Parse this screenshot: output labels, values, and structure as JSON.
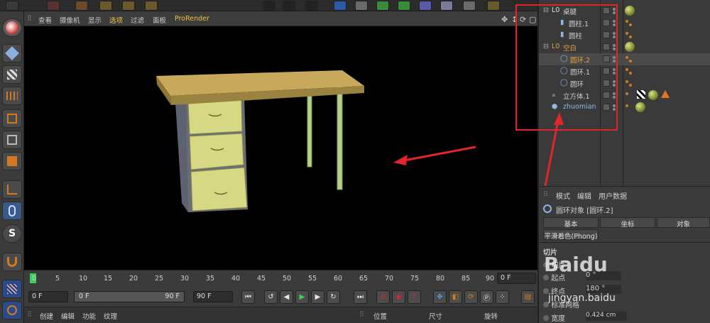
{
  "viewport_menu": [
    "查看",
    "摄像机",
    "显示",
    "选项",
    "过滤",
    "面板",
    "ProRender"
  ],
  "timeline": {
    "ticks": [
      "0",
      "5",
      "10",
      "15",
      "20",
      "25",
      "30",
      "35",
      "40",
      "45",
      "50",
      "55",
      "60",
      "65",
      "70",
      "75",
      "80",
      "85",
      "90"
    ],
    "current_frame": "0 F"
  },
  "playback": {
    "start_field": "0 F",
    "range_start": "0 F",
    "range_end": "90 F",
    "end_field": "90 F"
  },
  "bottom_menu": [
    "创建",
    "编辑",
    "功能",
    "纹理"
  ],
  "coord_headers": [
    "位置",
    "尺寸",
    "旋转"
  ],
  "object_manager": {
    "objects": [
      {
        "name": "桌腿",
        "color": "#cfcfcf",
        "level": 0,
        "icon": "null-group-icon"
      },
      {
        "name": "圆柱.1",
        "color": "#cfcfcf",
        "level": 1,
        "icon": "cylinder-icon"
      },
      {
        "name": "圆柱",
        "color": "#cfcfcf",
        "level": 1,
        "icon": "cylinder-icon"
      },
      {
        "name": "空白",
        "color": "#e0a23a",
        "level": 0,
        "icon": "null-group-icon"
      },
      {
        "name": "圆环.2",
        "color": "#e0a23a",
        "level": 1,
        "icon": "torus-icon"
      },
      {
        "name": "圆环.1",
        "color": "#cfcfcf",
        "level": 1,
        "icon": "torus-icon"
      },
      {
        "name": "圆环",
        "color": "#cfcfcf",
        "level": 1,
        "icon": "torus-icon"
      },
      {
        "name": "立方体.1",
        "color": "#cfcfcf",
        "level": 0,
        "icon": "cube-icon"
      },
      {
        "name": "zhuomian",
        "color": "#8fb8e8",
        "level": 0,
        "icon": "polygon-icon"
      }
    ]
  },
  "attribute_manager": {
    "menu": [
      "模式",
      "编辑",
      "用户数据"
    ],
    "title": "圆环对象 [圆环.2]",
    "tabs": [
      "基本",
      "坐标",
      "对象"
    ],
    "phong_tab": "平滑着色(Phong)",
    "section": "切片",
    "rows": [
      {
        "label": "切片",
        "value": ""
      },
      {
        "label": "起点",
        "value": "0 °"
      },
      {
        "label": "终点",
        "value": "180 °"
      },
      {
        "label": "标准网格",
        "value": ""
      },
      {
        "label": "宽度",
        "value": "0.424 cm"
      }
    ]
  },
  "watermark": {
    "text": "Baidu",
    "sub": "jingyan.baidu"
  },
  "colors": {
    "highlight_box": "#e0262c",
    "arrow": "#e0262c",
    "active_menu": "#f0c040",
    "desk_top": "#c8a85a",
    "drawer": "#d6d883",
    "leg": "#b6d08c",
    "selected_object": "#e0a23a"
  }
}
